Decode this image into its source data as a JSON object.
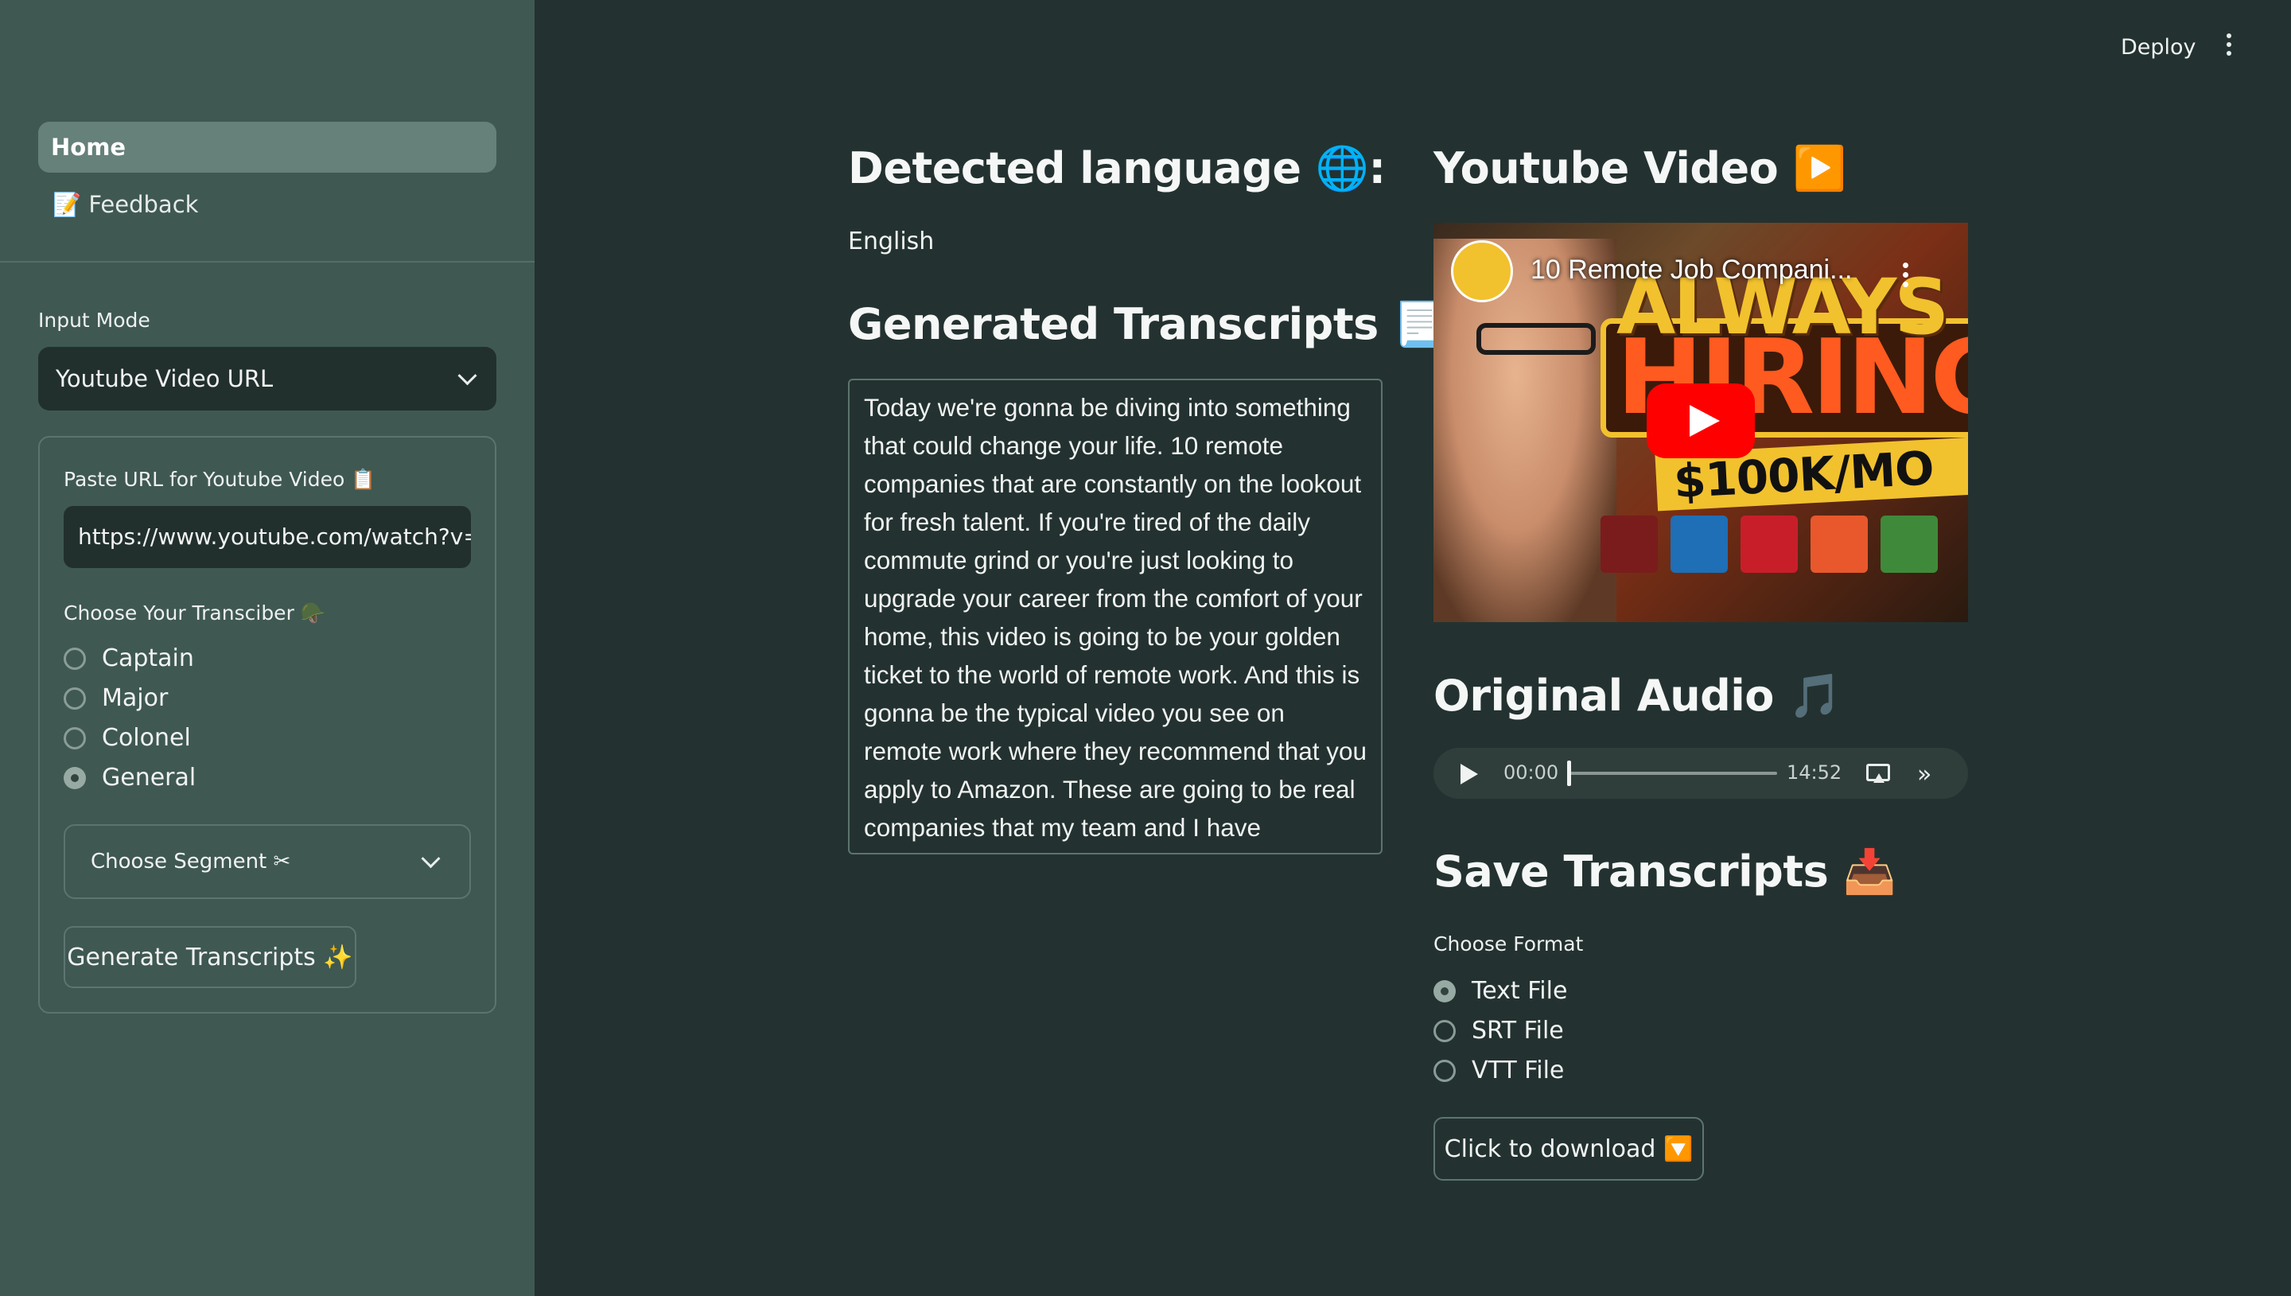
{
  "header": {
    "deploy_label": "Deploy"
  },
  "sidebar": {
    "nav": [
      {
        "label": "Home"
      },
      {
        "label": "📝 Feedback"
      }
    ],
    "input_mode": {
      "label": "Input Mode",
      "selected": "Youtube Video URL"
    },
    "url_field": {
      "label": "Paste URL for Youtube Video 📋",
      "value": "https://www.youtube.com/watch?v="
    },
    "transcriber": {
      "label": "Choose Your Transciber 🪖",
      "options": [
        "Captain",
        "Major",
        "Colonel",
        "General"
      ],
      "selected": "General"
    },
    "segment": {
      "label": "Choose Segment ✂"
    },
    "generate_button": "Generate Transcripts ✨"
  },
  "main": {
    "language_heading": "Detected language 🌐:",
    "language_value": "English",
    "transcripts_heading": "Generated Transcripts 📃:",
    "transcript_text": "Today we're gonna be diving into something that could change your life. 10 remote companies that are constantly on the lookout for fresh talent. If you're tired of the daily commute grind or you're just looking to upgrade your career from the comfort of your home, this video is going to be your golden ticket to the world of remote work. And this is gonna be the typical video you see on remote work where they recommend that you apply to Amazon. These are going to be real companies that my team and I have personally helped people get into. And",
    "video_heading": "Youtube Video ▶️",
    "video": {
      "title": "10 Remote Job Compani...",
      "thumb_top": "ALWAYS",
      "thumb_main": "HIRING",
      "thumb_money": "$100K/MO"
    },
    "audio_heading": "Original Audio 🎵",
    "audio": {
      "current": "00:00",
      "duration": "14:52",
      "progress": 0.0
    },
    "save_heading": "Save Transcripts 📥",
    "format": {
      "label": "Choose Format",
      "options": [
        "Text File",
        "SRT File",
        "VTT File"
      ],
      "selected": "Text File"
    },
    "download_button": "Click to download 🔽"
  }
}
